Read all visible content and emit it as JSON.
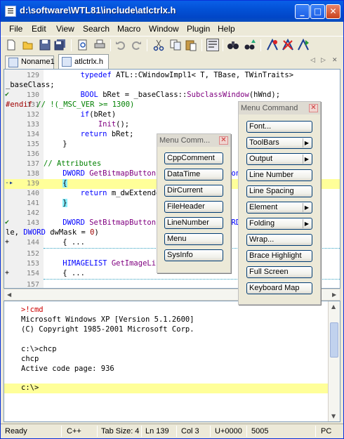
{
  "window": {
    "title": "d:\\software\\WTL81\\include\\atlctrlx.h"
  },
  "menu": [
    "File",
    "Edit",
    "View",
    "Search",
    "Macro",
    "Window",
    "Plugin",
    "Help"
  ],
  "toolbar_icons": [
    "new-file-icon",
    "open-folder-icon",
    "save-icon",
    "save-all-icon",
    "print-preview-icon",
    "print-icon",
    "undo-icon",
    "redo-icon",
    "cut-icon",
    "copy-icon",
    "paste-icon",
    "word-wrap-icon",
    "find-icon",
    "find-replace-icon",
    "macro-record-icon",
    "macro-stop-icon",
    "macro-play-icon"
  ],
  "tabs": [
    {
      "label": "Noname1"
    },
    {
      "label": "atlctrlx.h"
    }
  ],
  "editor": {
    "lines": [
      {
        "num": "129",
        "text": "        typedef ATL::CWindowImpl1< T, TBase, TWinTraits>"
      },
      {
        "num": "",
        "text": "_baseClass;"
      },
      {
        "num": "130",
        "text": "        BOOL bRet = _baseClass::SubclassWindow(hWnd);"
      },
      {
        "num": "131",
        "text": "#endif // !(_MSC_VER >= 1300)"
      },
      {
        "num": "132",
        "text": "        if(bRet)"
      },
      {
        "num": "133",
        "text": "            Init();"
      },
      {
        "num": "134",
        "text": "        return bRet;"
      },
      {
        "num": "135",
        "text": "    }"
      },
      {
        "num": "136",
        "text": ""
      },
      {
        "num": "137",
        "text": "// Attributes"
      },
      {
        "num": "138",
        "text": "    DWORD GetBitmapButtonExtendedStyle() const"
      },
      {
        "num": "139",
        "text": "    {"
      },
      {
        "num": "140",
        "text": "        return m_dwExtendedStyle;"
      },
      {
        "num": "141",
        "text": "    }"
      },
      {
        "num": "142",
        "text": ""
      },
      {
        "num": "143",
        "text": "    DWORD SetBitmapButtonExtendedStyle(DWORD dwStyle, DWORD dwMask = 0)"
      },
      {
        "num": "",
        "text": "le, DWORD dwMask = 0)"
      },
      {
        "num": "144",
        "text": "    { ..."
      },
      {
        "num": "152",
        "text": ""
      },
      {
        "num": "153",
        "text": "    HIMAGELIST GetImageList() const"
      },
      {
        "num": "154",
        "text": "    { ..."
      },
      {
        "num": "157",
        "text": ""
      }
    ]
  },
  "console": {
    "lines": [
      ">!cmd",
      "Microsoft Windows XP [Version 5.1.2600]",
      "(C) Copyright 1985-2001 Microsoft Corp.",
      "",
      "c:\\>chcp",
      "chcp",
      "Active code page: 936",
      "",
      "c:\\>"
    ]
  },
  "status": {
    "ready": "Ready",
    "lang": "C++",
    "tab": "Tab Size: 4",
    "ln": "Ln 139",
    "col": "Col 3",
    "char": "U+0000",
    "pos": "5005",
    "mode": "PC"
  },
  "palette_left": {
    "title": "Menu Comm...",
    "buttons": [
      "CppComment",
      "DataTime",
      "DirCurrent",
      "FileHeader",
      "LineNumber",
      "Menu",
      "SysInfo"
    ]
  },
  "palette_right": {
    "title": "Menu Command",
    "buttons": [
      {
        "label": "Font...",
        "sub": false
      },
      {
        "label": "ToolBars",
        "sub": true
      },
      {
        "label": "Output",
        "sub": true
      },
      {
        "label": "Line Number",
        "sub": false
      },
      {
        "label": "Line Spacing",
        "sub": false
      },
      {
        "label": "Element",
        "sub": true
      },
      {
        "label": "Folding",
        "sub": true
      },
      {
        "label": "Wrap...",
        "sub": false
      },
      {
        "label": "Brace Highlight",
        "sub": false
      },
      {
        "label": "Full Screen",
        "sub": false
      },
      {
        "label": "Keyboard Map",
        "sub": false
      }
    ]
  }
}
